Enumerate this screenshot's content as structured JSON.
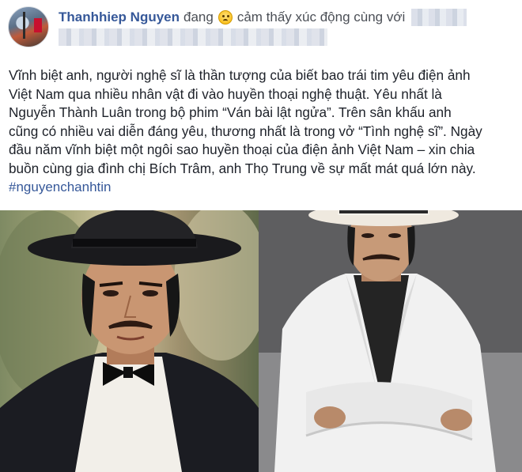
{
  "post": {
    "author": "Thanhhiep Nguyen",
    "feeling_prefix": "đang",
    "feeling_text": "cảm thấy xúc động cùng với",
    "text_lines": [
      "Vĩnh biệt anh, người nghệ sĩ là thần tượng của biết bao trái tim yêu điện ảnh",
      "Việt Nam qua nhiều nhân vật đi vào huyền thoại nghệ thuật. Yêu nhất là",
      "Nguyễn Thành Luân trong bộ phim “Ván bài lật ngửa”. Trên sân khấu anh",
      "cũng có nhiều vai diễn đáng yêu, thương nhất là trong vở “Tình nghệ sĩ”. Ngày",
      "đầu năm vĩnh biệt một ngôi sao huyền thoại của điện ảnh Việt Nam – xin chia",
      "buồn cùng gia đình chị Bích Trâm, anh Thọ Trung về sự mất mát quá lớn này."
    ],
    "hashtag": "#nguyenchanhtin"
  },
  "icons": {
    "feeling_emoji": "sad-face-icon"
  },
  "colors": {
    "link": "#365899",
    "text": "#1d2129",
    "secondary": "#4b4f56"
  }
}
